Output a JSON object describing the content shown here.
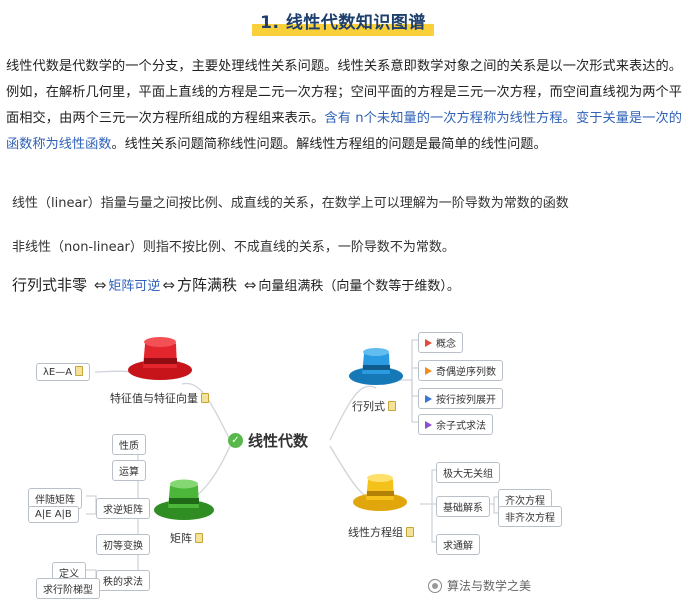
{
  "title": "1. 线性代数知识图谱",
  "paragraph": {
    "p1": "线性代数是代数学的一个分支，主要处理线性关系问题。线性关系意即数学对象之间的关系是以一次形式来表达的。例如，在解析几何里，平面上直线的方程是二元一次方程；空间平面的方程是三元一次方程，而空间直线视为两个平面相交，由两个三元一次方程所组成的方程组来表示。",
    "p2_blue": "含有 n个未知量的一次方程称为线性方程。变于关量是一次的函数称为线性函数",
    "p3": "。线性关系问题简称线性问题。解线性方程组的问题是最简单的线性问题。"
  },
  "linear_def": "线性（linear）指量与量之间按比例、成直线的关系，在数学上可以理解为一阶导数为常数的函数",
  "nonlinear_def": "非线性（non-linear）则指不按比例、不成直线的关系，一阶导数不为常数。",
  "equivalence": {
    "a": "行列式非零",
    "arrow": "⇔",
    "b": "矩阵可逆",
    "c": "方阵满秩",
    "d": "向量组满秩",
    "note": "（向量个数等于维数）。"
  },
  "mindmap": {
    "center": "线性代数",
    "eigen": {
      "label": "特征值与特征向量",
      "leaf": "λE—A"
    },
    "determinant": {
      "label": "行列式",
      "items": [
        "概念",
        "奇偶逆序列数",
        "按行按列展开",
        "余子式求法"
      ]
    },
    "matrix": {
      "label": "矩阵",
      "items": [
        "性质",
        "运算",
        "求逆矩阵",
        "初等变换",
        "秩的求法"
      ],
      "inverse_children": [
        "伴随矩阵",
        "A|E    A|B"
      ],
      "rank_children": [
        "定义",
        "求行阶梯型"
      ]
    },
    "equations": {
      "label": "线性方程组",
      "items": [
        "极大无关组",
        "基础解系",
        "求通解"
      ],
      "basis_children": [
        "齐次方程",
        "非齐次方程"
      ]
    }
  },
  "watermark": "算法与数学之美"
}
